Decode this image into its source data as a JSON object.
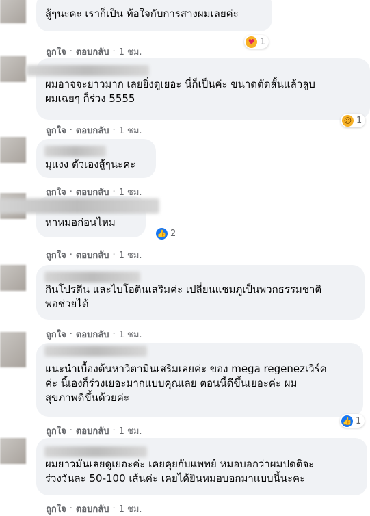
{
  "actions": {
    "like": "ถูกใจ",
    "reply": "ตอบกลับ",
    "time": "1 ชม.",
    "dot": "·"
  },
  "comments": [
    {
      "text": "สู้ๆนะคะ เราก็เป็น ท้อใจกับการสางผมเลยค่ะ",
      "reaction": {
        "icon": "care-reaction-icon",
        "count": "1"
      }
    },
    {
      "text": "ผมอาจจะยาวมาก เลยยิ่งดูเยอะ นี่ก็เป็นค่ะ ขนาดตัดสั้นแล้วลูบ\nผมเฉยๆ ก็ร่วง 5555",
      "reaction": {
        "icon": "haha-reaction-icon",
        "count": "1"
      }
    },
    {
      "text": "มุแงง ตัวเองสู้ๆนะคะ",
      "reaction": null
    },
    {
      "text": "หาหมอก่อนไหม",
      "reaction": {
        "icon": "like-reaction-icon",
        "count": "2"
      }
    },
    {
      "text": "กินโปรตีน และไบโอตินเสริมค่ะ เปลี่ยนแชมภูเป็นพวกธรรมชาติ\nพอช่วยได้",
      "reaction": null
    },
    {
      "text": "แนะนำเบื้องต้นหาวิตามินเสริมเลยค่ะ ของ mega regenezเวิร์ค\nค่ะ นี้เองก็ร่วงเยอะมากแบบคุณเลย ตอนนี้ดีขึ้นเยอะค่ะ ผม\nสุขภาพดีขึ้นด้วยค่ะ",
      "reaction": {
        "icon": "like-reaction-icon",
        "count": "1"
      }
    },
    {
      "text": "ผมยาวมันเลยดูเยอะค่ะ เคยคุยกับแพทย์ หมอบอกว่าผมปดติจะ\nร่วงวันละ 50-100 เส้นค่ะ เคยได้ยินหมอบอกมาแบบนี้นะคะ",
      "reaction": null
    }
  ]
}
